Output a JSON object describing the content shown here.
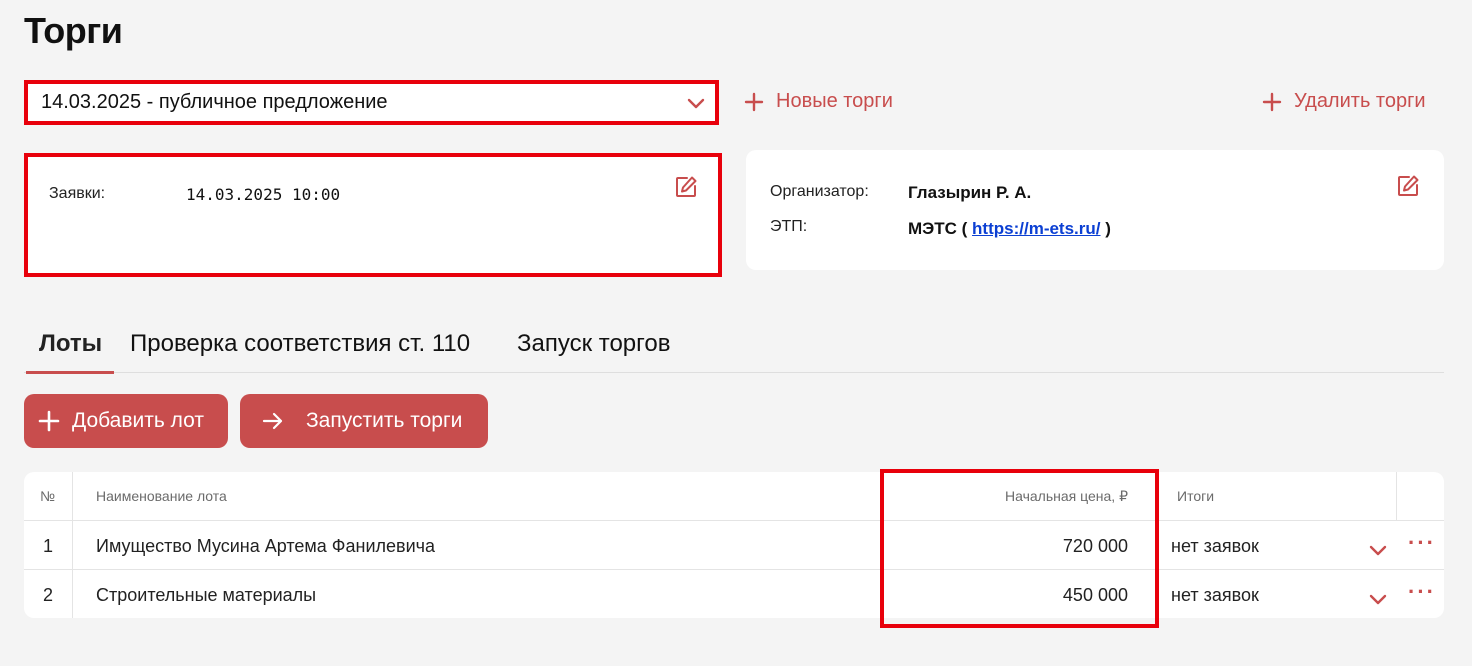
{
  "page": {
    "title": "Торги"
  },
  "auction_select": {
    "value": "14.03.2025 - публичное предложение"
  },
  "actions": {
    "new_auction": "Новые торги",
    "delete_auction": "Удалить торги"
  },
  "schedule_card": {
    "applications_label": "Заявки:",
    "applications_value": "14.03.2025 10:00"
  },
  "organizer_card": {
    "organizer_label": "Организатор:",
    "organizer_value": "Глазырин Р. А.",
    "etp_label": "ЭТП:",
    "etp_name": "МЭТС (",
    "etp_link": "https://m-ets.ru/",
    "etp_close": ")"
  },
  "tabs": [
    {
      "label": "Лоты",
      "active": true
    },
    {
      "label": "Проверка соответствия ст. 110",
      "active": false
    },
    {
      "label": "Запуск торгов",
      "active": false
    }
  ],
  "buttons": {
    "add_lot": "Добавить лот",
    "start_auction": "Запустить торги"
  },
  "lots_table": {
    "headers": {
      "num": "№",
      "name": "Наименование лота",
      "price": "Начальная цена, ₽",
      "result": "Итоги"
    },
    "rows": [
      {
        "num": "1",
        "name": "Имущество Мусина Артема Фанилевича",
        "price": "720 000",
        "result": "нет заявок"
      },
      {
        "num": "2",
        "name": "Строительные материалы",
        "price": "450 000",
        "result": "нет заявок"
      }
    ]
  },
  "colors": {
    "accent": "#c84d4d",
    "highlight": "#e8000b",
    "link": "#0b3fd3",
    "background": "#f4f4f4"
  },
  "icons": {
    "select": "chevron-down-icon",
    "add": "plus-icon",
    "edit": "edit-icon",
    "start": "arrow-right-icon",
    "row_menu": "more-dots-icon",
    "row_expand": "chevron-down-icon"
  }
}
